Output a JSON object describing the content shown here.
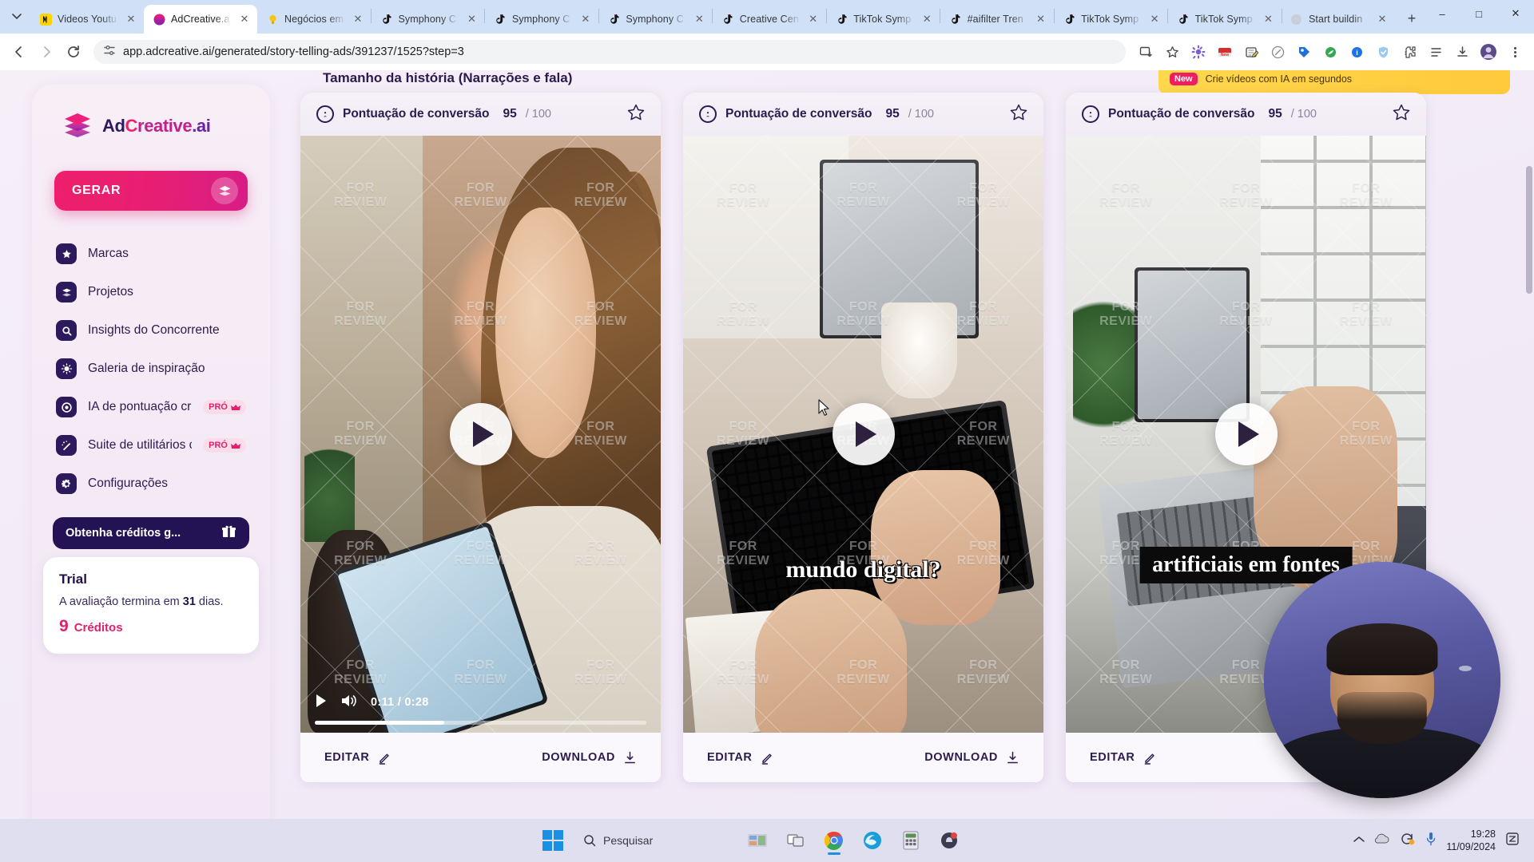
{
  "browser": {
    "tabs": [
      {
        "label": "Videos Youtu",
        "favicon": "youtube-icon",
        "active": false
      },
      {
        "label": "AdCreative.a",
        "favicon": "adcreative-icon",
        "active": true
      },
      {
        "label": "Negócios em",
        "favicon": "bulb-icon",
        "active": false
      },
      {
        "label": "Symphony C",
        "favicon": "tiktok-icon",
        "active": false
      },
      {
        "label": "Symphony C",
        "favicon": "tiktok-icon",
        "active": false
      },
      {
        "label": "Symphony C",
        "favicon": "tiktok-icon",
        "active": false
      },
      {
        "label": "Creative Cen",
        "favicon": "tiktok-icon",
        "active": false
      },
      {
        "label": "TikTok Symp",
        "favicon": "tiktok-icon",
        "active": false
      },
      {
        "label": "#aifilter Tren",
        "favicon": "tiktok-icon",
        "active": false
      },
      {
        "label": "TikTok Symp",
        "favicon": "tiktok-icon",
        "active": false
      },
      {
        "label": "TikTok Symp",
        "favicon": "tiktok-icon",
        "active": false
      },
      {
        "label": "Start buildin",
        "favicon": "generic-icon",
        "active": false
      }
    ],
    "new_tab_label": "+",
    "window_controls": {
      "minimize": "–",
      "maximize": "□",
      "close": "✕"
    },
    "url": "app.adcreative.ai/generated/story-telling-ads/391237/1525?step=3",
    "tab_close_label": "✕"
  },
  "sidebar": {
    "logo": {
      "ad": "Ad",
      "c": "C",
      "reative": "reative",
      "ai": ".ai"
    },
    "generate_button": "GERAR",
    "items": [
      {
        "label": "Marcas",
        "icon": "star-icon",
        "pro": null
      },
      {
        "label": "Projetos",
        "icon": "layers-icon",
        "pro": null
      },
      {
        "label": "Insights do Concorrente",
        "icon": "search-icon",
        "pro": null
      },
      {
        "label": "Galeria de inspiração",
        "icon": "lightbulb-icon",
        "pro": null
      },
      {
        "label": "IA de pontuação cri...",
        "icon": "gauge-icon",
        "pro": "PRÓ"
      },
      {
        "label": "Suite de utilitários c...",
        "icon": "wand-icon",
        "pro": "PRÓ"
      },
      {
        "label": "Configurações",
        "icon": "gear-icon",
        "pro": null
      }
    ],
    "credits_button": "Obtenha créditos g...",
    "trial": {
      "title": "Trial",
      "text_before": "A avaliação termina em",
      "days": "31",
      "text_after": "dias.",
      "credits_count": "9",
      "credits_label": "Créditos"
    }
  },
  "main": {
    "page_title": "Tamanho da história (Narrações e fala)",
    "banner": {
      "badge": "New",
      "text": "Crie vídeos com IA em segundos"
    },
    "cards": [
      {
        "score_label": "Pontuação de conversão",
        "score_value": "95",
        "score_max": "/ 100",
        "caption": "",
        "video": {
          "current_time": "0:11",
          "duration": "0:28",
          "time_display": "0:11 / 0:28",
          "progress_percent": 39
        },
        "edit_label": "EDITAR",
        "download_label": "DOWNLOAD",
        "show_controls": true,
        "watermark": "FOR REVIEW"
      },
      {
        "score_label": "Pontuação de conversão",
        "score_value": "95",
        "score_max": "/ 100",
        "caption": "mundo digital?",
        "video": {
          "current_time": "",
          "duration": "",
          "time_display": "",
          "progress_percent": 0
        },
        "edit_label": "EDITAR",
        "download_label": "DOWNLOAD",
        "show_controls": false,
        "watermark": "FOR REVIEW"
      },
      {
        "score_label": "Pontuação de conversão",
        "score_value": "95",
        "score_max": "/ 100",
        "caption": "artificiais em fontes",
        "video": {
          "current_time": "",
          "duration": "",
          "time_display": "",
          "progress_percent": 0
        },
        "edit_label": "EDITAR",
        "download_label": "",
        "show_controls": false,
        "watermark": "FOR REVIEW"
      }
    ]
  },
  "taskbar": {
    "search_placeholder": "Pesquisar",
    "time": "19:28",
    "date": "11/09/2024"
  },
  "colors": {
    "accent_pink": "#e11f6d",
    "deep_purple": "#241354",
    "page_bg": "#f4eef7"
  }
}
